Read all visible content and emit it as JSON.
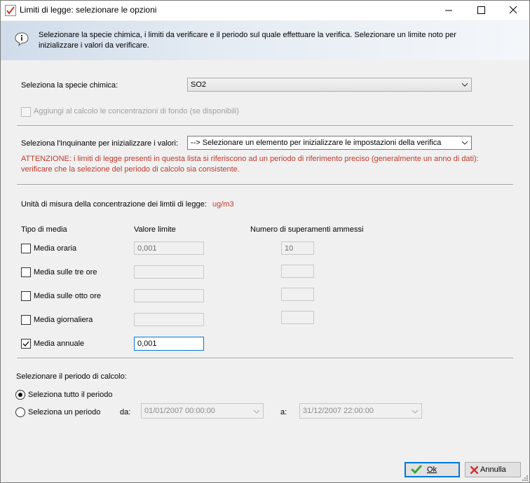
{
  "window": {
    "title": "Limiti di legge: selezionare le opzioni"
  },
  "info": {
    "text": "Selezionare la specie chimica, i limiti da verificare e il periodo sul quale effettuare la verifica. Selezionare un limite noto per inizializzare i valori da verificare."
  },
  "species": {
    "label": "Seleziona la specie chimica:",
    "value": "SO2"
  },
  "background": {
    "label": "Aggiungi al calcolo le concentrazioni di fondo (se disponibili)"
  },
  "pollutant": {
    "label": "Seleziona l'Inquinante per inizializzare i valori:",
    "value": "--> Selezionare un elemento per inizializzare le impostazioni della verifica",
    "warning": "ATTENZIONE: i  limiti di legge presenti in questa lista si riferiscono ad un periodo di riferimento preciso (generalmente un anno di dati): verificare che la selezione del periodo di calcolo sia consistente."
  },
  "units": {
    "label": "Unità di misura della concentrazione dei limtii di legge:",
    "value": "ug/m3"
  },
  "table": {
    "headers": [
      "Tipo di media",
      "Valore limite",
      "Numero di superamenti ammessi"
    ],
    "rows": [
      {
        "label": "Media oraria",
        "checked": false,
        "limit": "0,001",
        "exceed": "10"
      },
      {
        "label": "Media sulle tre ore",
        "checked": false,
        "limit": "",
        "exceed": ""
      },
      {
        "label": "Media sulle otto ore",
        "checked": false,
        "limit": "",
        "exceed": ""
      },
      {
        "label": "Media giornaliera",
        "checked": false,
        "limit": "",
        "exceed": ""
      },
      {
        "label": "Media annuale",
        "checked": true,
        "limit": "0,001",
        "exceed": null
      }
    ]
  },
  "period": {
    "label": "Selezionare il periodo di calcolo:",
    "option_all": "Seleziona tutto il periodo",
    "option_range": "Seleziona un periodo",
    "from_label": "da:",
    "from_value": "01/01/2007 00:00:00",
    "to_label": "a:",
    "to_value": "31/12/2007 22:00:00"
  },
  "buttons": {
    "ok": "Ok",
    "cancel": "Annulla"
  },
  "colors": {
    "warning": "#c0392b",
    "units": "#c0392b",
    "focus": "#0078d7"
  }
}
